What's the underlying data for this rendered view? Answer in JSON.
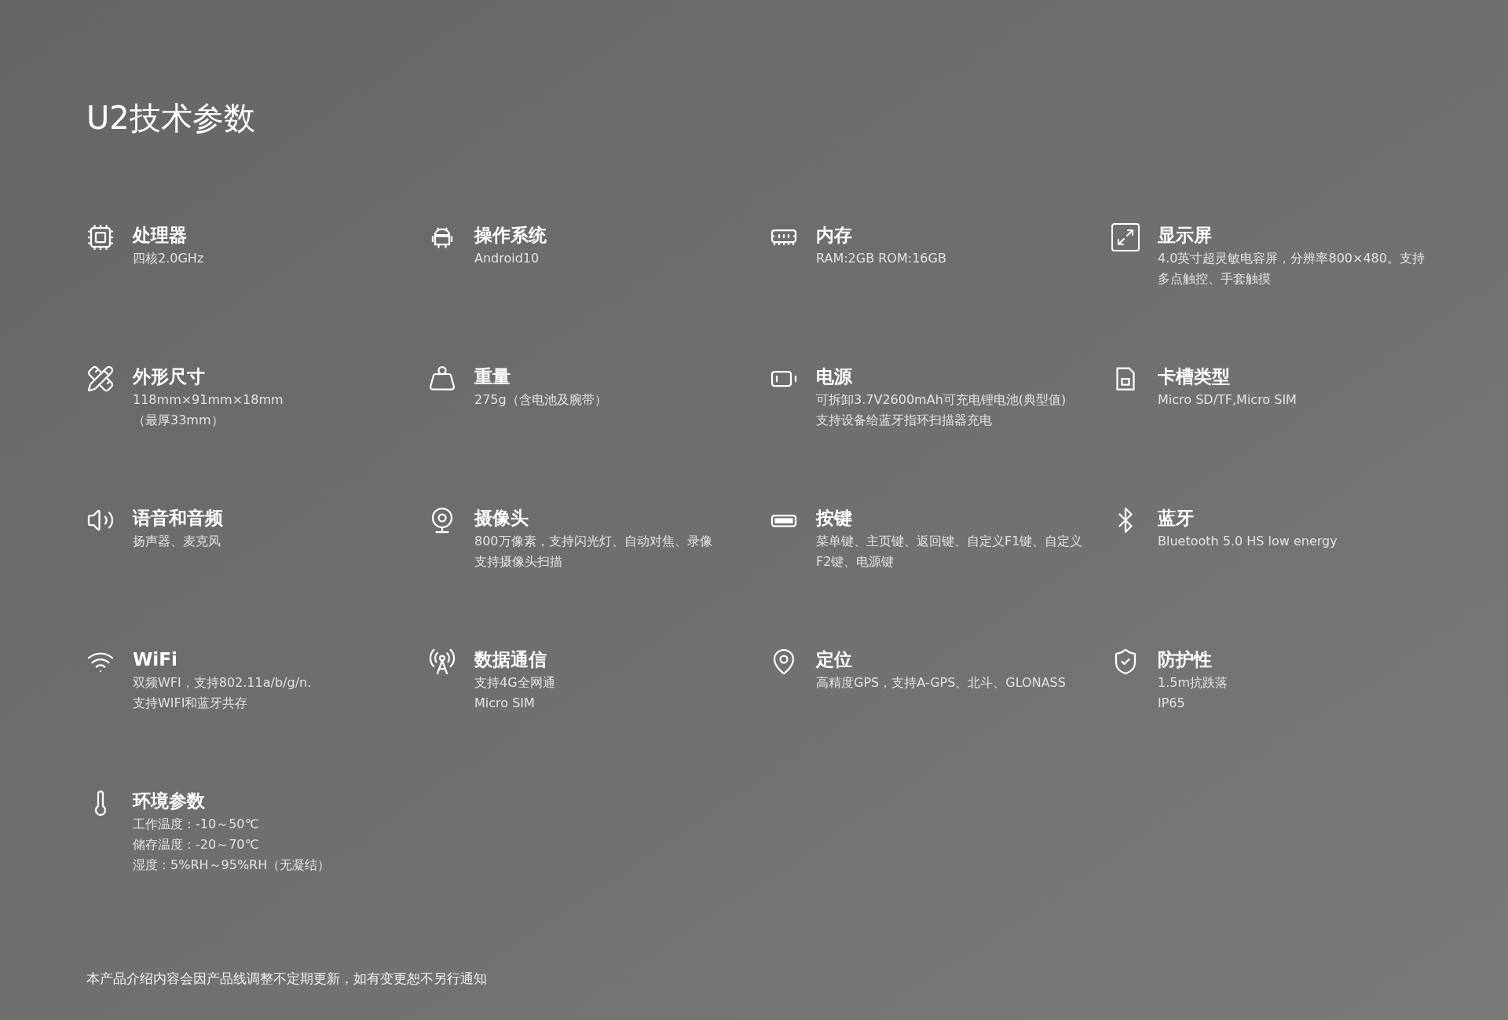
{
  "title": "U2技术参数",
  "specs": [
    {
      "name": "处理器",
      "lines": [
        "四核2.0GHz"
      ]
    },
    {
      "name": "操作系统",
      "lines": [
        "Android10"
      ]
    },
    {
      "name": "内存",
      "lines": [
        "RAM:2GB ROM:16GB"
      ]
    },
    {
      "name": "显示屏",
      "lines": [
        "4.0英寸超灵敏电容屏，分辨率800×480。支持多点触控、手套触摸"
      ]
    },
    {
      "name": "外形尺寸",
      "lines": [
        "118mm×91mm×18mm",
        "（最厚33mm）"
      ]
    },
    {
      "name": "重量",
      "lines": [
        "275g（含电池及腕带）"
      ]
    },
    {
      "name": "电源",
      "lines": [
        "可拆卸3.7V2600mAh可充电锂电池(典型值)",
        "支持设备给蓝牙指环扫描器充电"
      ]
    },
    {
      "name": "卡槽类型",
      "lines": [
        "Micro SD/TF,Micro SIM"
      ]
    },
    {
      "name": "语音和音频",
      "lines": [
        "扬声器、麦克风"
      ]
    },
    {
      "name": "摄像头",
      "lines": [
        "800万像素，支持闪光灯、自动对焦、录像",
        "支持摄像头扫描"
      ]
    },
    {
      "name": "按键",
      "lines": [
        "菜单键、主页键、返回键、自定义F1键、自定义F2键、电源键"
      ]
    },
    {
      "name": "蓝牙",
      "lines": [
        "Bluetooth 5.0 HS low energy"
      ]
    },
    {
      "name": "WiFi",
      "lines": [
        "双频WFI，支持802.11a/b/g/n.",
        "支持WIFI和蓝牙共存"
      ]
    },
    {
      "name": "数据通信",
      "lines": [
        "支持4G全网通",
        "Micro SIM"
      ]
    },
    {
      "name": "定位",
      "lines": [
        "高精度GPS，支持A-GPS、北斗、GLONASS"
      ]
    },
    {
      "name": "防护性",
      "lines": [
        "1.5m抗跌落",
        "IP65"
      ]
    },
    {
      "name": "环境参数",
      "lines": [
        "工作温度：-10～50℃",
        "储存温度：-20～70℃",
        "湿度：5%RH～95%RH（无凝结）"
      ]
    }
  ],
  "footer": "本产品介绍内容会因产品线调整不定期更新，如有变更恕不另行通知"
}
